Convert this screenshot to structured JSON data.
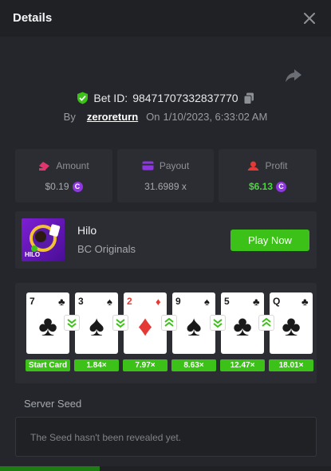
{
  "header": {
    "title": "Details"
  },
  "bet": {
    "label": "Bet ID:",
    "id": "98471707332837770",
    "by_label": "By",
    "user": "zeroreturn",
    "on_label": "On",
    "datetime": "1/10/2023, 6:33:02 AM"
  },
  "stats": {
    "amount": {
      "label": "Amount",
      "value": "$0.19"
    },
    "payout": {
      "label": "Payout",
      "value": "31.6989 x"
    },
    "profit": {
      "label": "Profit",
      "value": "$6.13"
    }
  },
  "game": {
    "name": "Hilo",
    "provider": "BC Originals",
    "thumb_text": "HILO",
    "play_label": "Play Now"
  },
  "cards": [
    {
      "rank": "7",
      "suit": "♣",
      "color": "black",
      "mult": "Start Card",
      "guess": "none"
    },
    {
      "rank": "3",
      "suit": "♠",
      "color": "black",
      "mult": "1.84×",
      "guess": "lower"
    },
    {
      "rank": "2",
      "suit": "♦",
      "color": "red",
      "mult": "7.97×",
      "guess": "lower"
    },
    {
      "rank": "9",
      "suit": "♠",
      "color": "black",
      "mult": "8.63×",
      "guess": "higher"
    },
    {
      "rank": "5",
      "suit": "♣",
      "color": "black",
      "mult": "12.47×",
      "guess": "lower"
    },
    {
      "rank": "Q",
      "suit": "♣",
      "color": "black",
      "mult": "18.01×",
      "guess": "higher"
    }
  ],
  "seed": {
    "label": "Server Seed",
    "text": "The Seed hasn't been revealed yet."
  },
  "colors": {
    "accent_green": "#3bc117",
    "coin_purple": "#8e37e0",
    "shield_green": "#3bc117",
    "amount_icon": "#e0356d",
    "payout_icon": "#8e37e0",
    "profit_icon": "#e53935"
  },
  "icons": {
    "close": "close-icon",
    "share": "share-icon",
    "shield": "shield-check-icon",
    "copy": "copy-icon",
    "coin": "bc-coin-icon"
  }
}
